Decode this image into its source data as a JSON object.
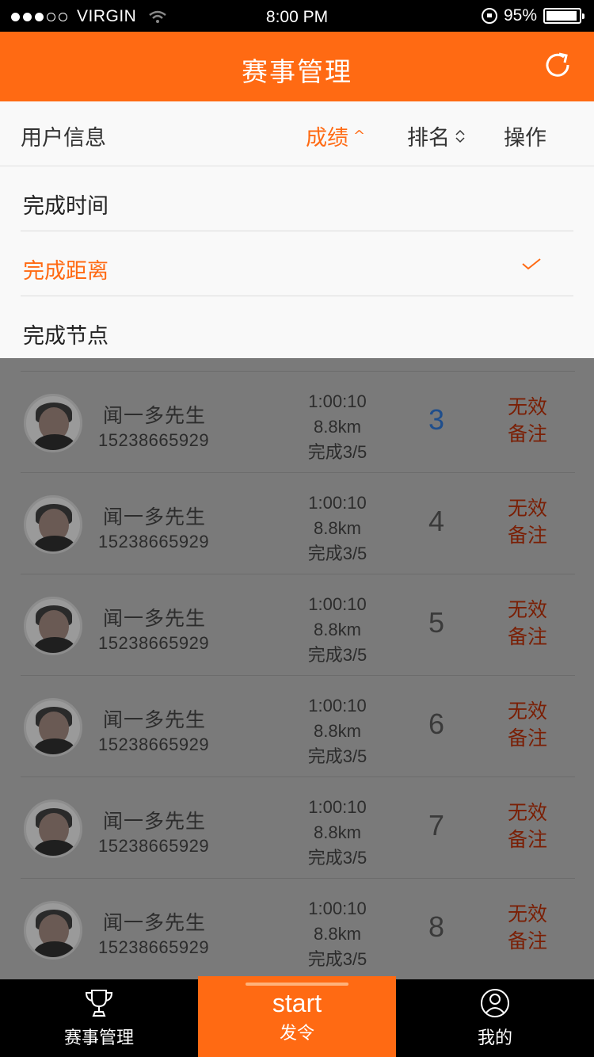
{
  "status_bar": {
    "signal_filled": 3,
    "signal_total": 5,
    "carrier": "VIRGIN",
    "time": "8:00 PM",
    "battery": "95%"
  },
  "header": {
    "title": "赛事管理"
  },
  "sort_bar": {
    "user_info": "用户信息",
    "score": "成绩",
    "score_caret": "^",
    "rank": "排名",
    "action": "操作"
  },
  "dropdown": {
    "items": [
      {
        "label": "完成时间",
        "selected": false
      },
      {
        "label": "完成距离",
        "selected": true
      },
      {
        "label": "完成节点",
        "selected": false
      }
    ]
  },
  "rows": [
    {
      "name": "闻一多先生",
      "phone": "15238665929",
      "time": "1:00:10",
      "distance": "8.8km",
      "progress": "完成3/5",
      "rank": "3",
      "invalid": "无效",
      "note": "备注"
    },
    {
      "name": "闻一多先生",
      "phone": "15238665929",
      "time": "1:00:10",
      "distance": "8.8km",
      "progress": "完成3/5",
      "rank": "4",
      "invalid": "无效",
      "note": "备注"
    },
    {
      "name": "闻一多先生",
      "phone": "15238665929",
      "time": "1:00:10",
      "distance": "8.8km",
      "progress": "完成3/5",
      "rank": "5",
      "invalid": "无效",
      "note": "备注"
    },
    {
      "name": "闻一多先生",
      "phone": "15238665929",
      "time": "1:00:10",
      "distance": "8.8km",
      "progress": "完成3/5",
      "rank": "6",
      "invalid": "无效",
      "note": "备注"
    },
    {
      "name": "闻一多先生",
      "phone": "15238665929",
      "time": "1:00:10",
      "distance": "8.8km",
      "progress": "完成3/5",
      "rank": "7",
      "invalid": "无效",
      "note": "备注"
    },
    {
      "name": "闻一多先生",
      "phone": "15238665929",
      "time": "1:00:10",
      "distance": "8.8km",
      "progress": "完成3/5",
      "rank": "8",
      "invalid": "无效",
      "note": "备注"
    }
  ],
  "tab_bar": {
    "left": {
      "label": "赛事管理",
      "icon": "trophy-icon"
    },
    "center": {
      "label": "start",
      "sub": "发令"
    },
    "right": {
      "label": "我的",
      "icon": "user-icon"
    }
  },
  "colors": {
    "accent": "#ff6a13",
    "rank_top": "#1f4e8c",
    "action": "#7a1f05"
  }
}
